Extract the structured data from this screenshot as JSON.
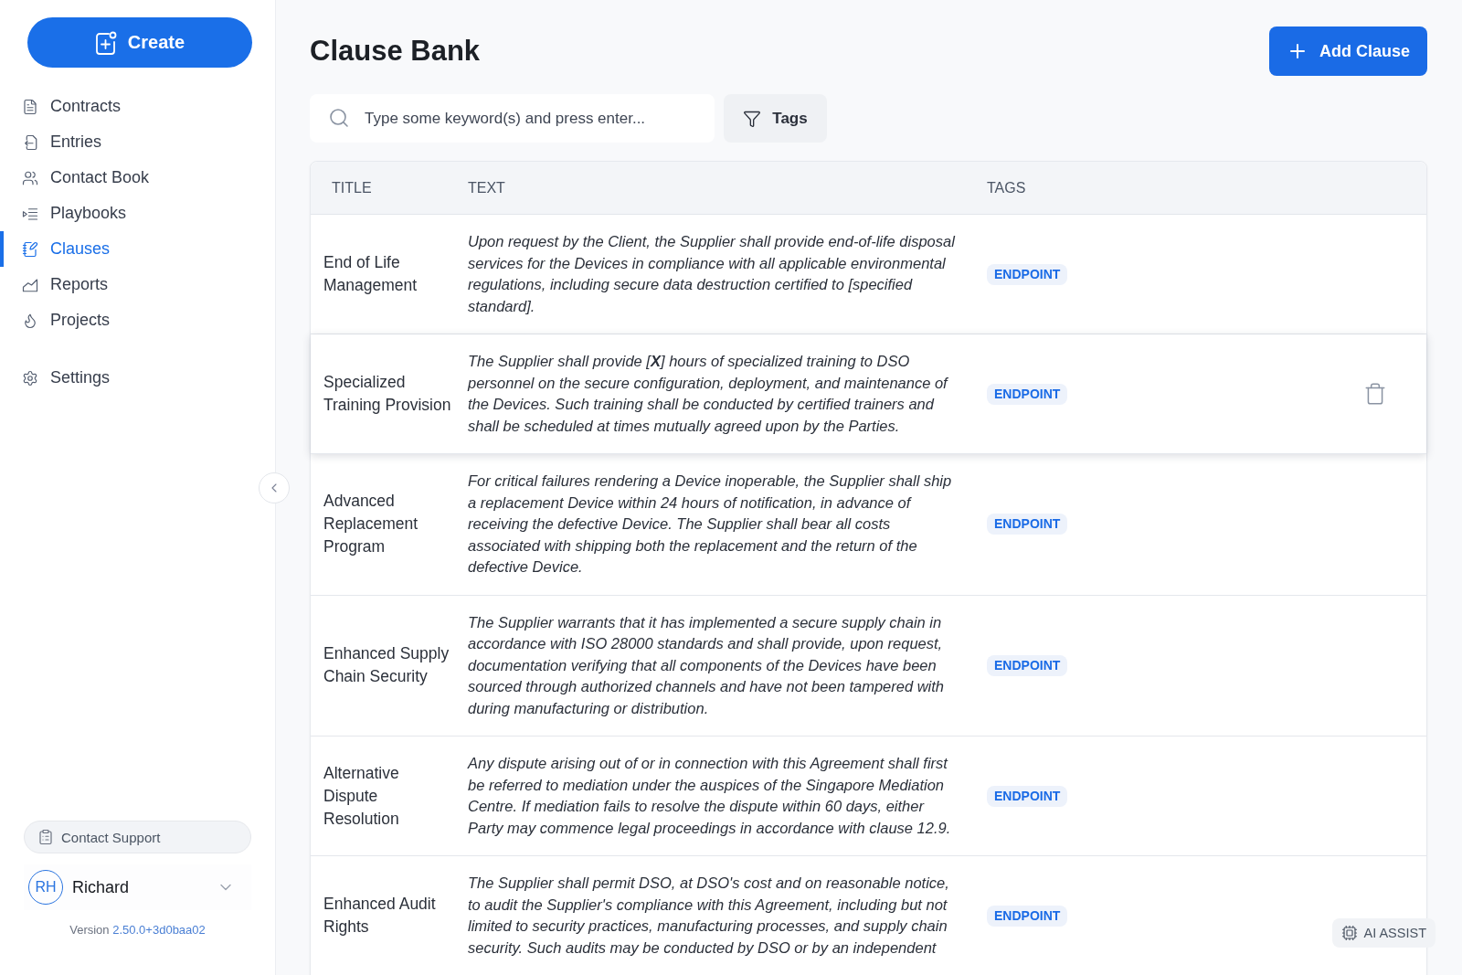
{
  "sidebar": {
    "create_button": "Create",
    "nav_items": [
      {
        "label": "Contracts",
        "selected": false
      },
      {
        "label": "Entries",
        "selected": false
      },
      {
        "label": "Contact Book",
        "selected": false
      },
      {
        "label": "Playbooks",
        "selected": false
      },
      {
        "label": "Clauses",
        "selected": true
      },
      {
        "label": "Reports",
        "selected": false
      },
      {
        "label": "Projects",
        "selected": false
      }
    ],
    "settings_item": {
      "label": "Settings",
      "selected": false
    },
    "contact_support": "Contact Support",
    "user": {
      "initials": "RH",
      "name": "Richard"
    },
    "version": {
      "label": "Version",
      "number": "2.50.0+3d0baa02"
    }
  },
  "header": {
    "title": "Clause Bank",
    "add_button": "Add Clause"
  },
  "toolbar": {
    "search": {
      "placeholder": "Type some keyword(s) and press enter..."
    },
    "filter_button": "Tags"
  },
  "table": {
    "columns": [
      "TITLE",
      "TEXT",
      "TAGS"
    ],
    "rows": [
      {
        "title": "End of Life Management",
        "text": "Upon request by the Client, the Supplier shall provide end-of-life disposal services for the Devices in compliance with all applicable environmental regulations, including secure data destruction certified to [specified standard].",
        "tags": [
          "ENDPOINT"
        ],
        "hovered": false
      },
      {
        "title": "Specialized Training Provision",
        "text": "The Supplier shall provide [**X**] hours of specialized training to DSO personnel on the secure configuration, deployment, and maintenance of the Devices. Such training shall be conducted by certified trainers and shall be scheduled at times mutually agreed upon by the Parties.",
        "tags": [
          "ENDPOINT"
        ],
        "hovered": true
      },
      {
        "title": "Advanced Replacement Program",
        "text": "For critical failures rendering a Device inoperable, the Supplier shall ship a replacement Device within 24 hours of notification, in advance of receiving the defective Device. The Supplier shall bear all costs associated with shipping both the replacement and the return of the defective Device.",
        "tags": [
          "ENDPOINT"
        ],
        "hovered": false
      },
      {
        "title": "Enhanced Supply Chain Security",
        "text": "The Supplier warrants that it has implemented a secure supply chain in accordance with ISO 28000 standards and shall provide, upon request, documentation verifying that all components of the Devices have been sourced through authorized channels and have not been tampered with during manufacturing or distribution.",
        "tags": [
          "ENDPOINT"
        ],
        "hovered": false
      },
      {
        "title": "Alternative Dispute Resolution",
        "text": "Any dispute arising out of or in connection with this Agreement shall first be referred to mediation under the auspices of the Singapore Mediation Centre. If mediation fails to resolve the dispute within 60 days, either Party may commence legal proceedings in accordance with clause 12.9.",
        "tags": [
          "ENDPOINT"
        ],
        "hovered": false
      },
      {
        "title": "Enhanced Audit Rights",
        "text": "The Supplier shall permit DSO, at DSO's cost and on reasonable notice, to audit the Supplier's compliance with this Agreement, including but not limited to security practices, manufacturing processes, and supply chain security. Such audits may be conducted by DSO or by an independent",
        "tags": [
          "ENDPOINT"
        ],
        "hovered": false
      }
    ]
  },
  "ai_assist_button": "AI ASSIST"
}
